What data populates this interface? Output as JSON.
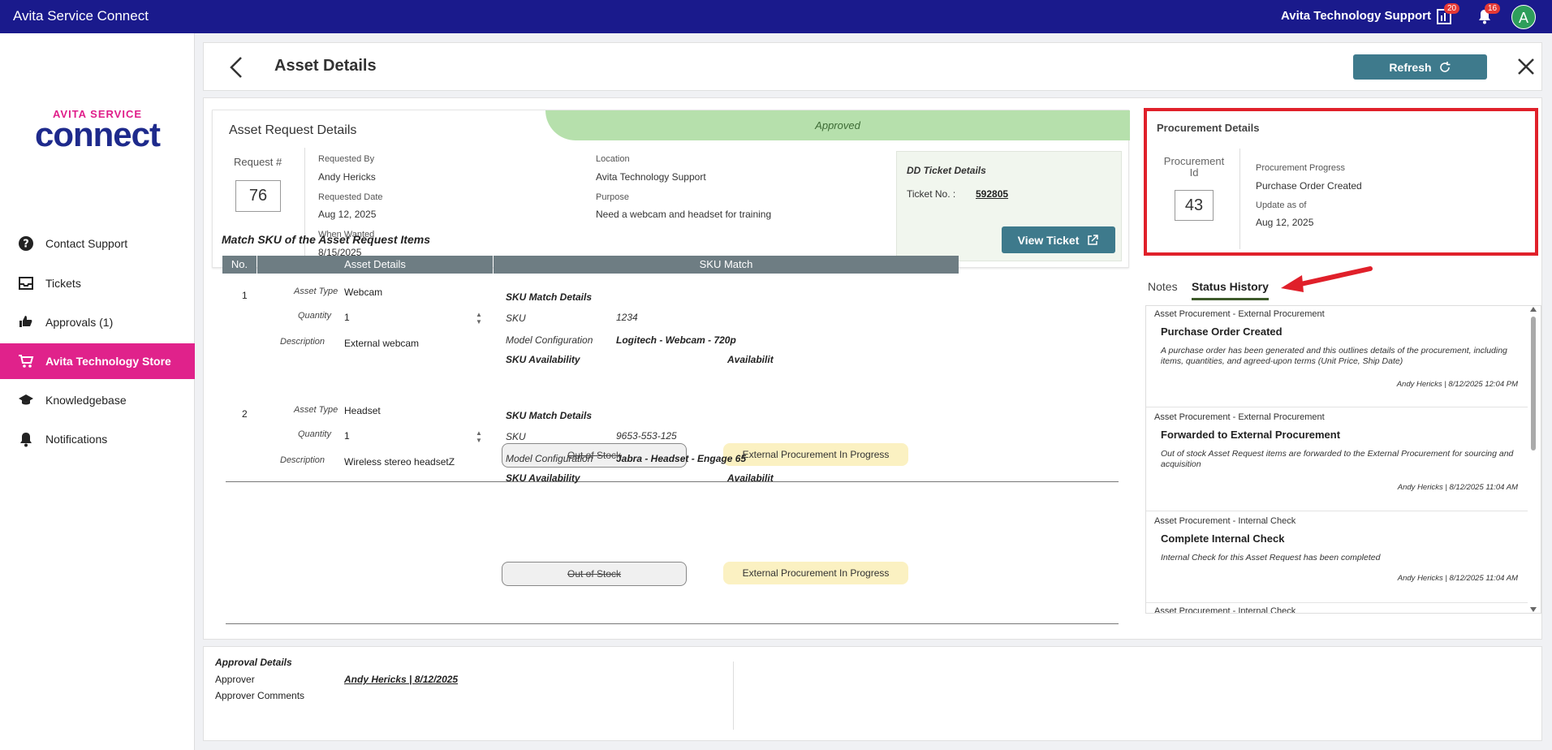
{
  "topbar": {
    "app_title": "Avita Service Connect",
    "org_name": "Avita Technology Support",
    "reports_badge": "20",
    "notifications_badge": "16",
    "avatar_initial": "A"
  },
  "sidebar": {
    "logo_top": "AVITA SERVICE",
    "logo_main": "connect",
    "items": [
      {
        "label": "Contact Support",
        "icon": "question-circle-icon"
      },
      {
        "label": "Tickets",
        "icon": "inbox-icon"
      },
      {
        "label": "Approvals  (1)",
        "icon": "thumbs-icon"
      },
      {
        "label": "Avita Technology Store",
        "icon": "cart-icon"
      },
      {
        "label": "Knowledgebase",
        "icon": "graduation-cap-icon"
      },
      {
        "label": "Notifications",
        "icon": "bell-icon"
      }
    ]
  },
  "header": {
    "title": "Asset Details",
    "refresh_label": "Refresh"
  },
  "request": {
    "section_title": "Asset Request Details",
    "status": "Approved",
    "request_label": "Request #",
    "request_number": "76",
    "requested_by_label": "Requested By",
    "requested_by": "Andy Hericks",
    "requested_date_label": "Requested Date",
    "requested_date": "Aug 12, 2025",
    "when_wanted_label": "When Wanted",
    "when_wanted": "8/15/2025",
    "location_label": "Location",
    "location": "Avita Technology Support",
    "purpose_label": "Purpose",
    "purpose": "Need a webcam and headset for training"
  },
  "dd_ticket": {
    "title": "DD Ticket Details",
    "ticket_label": "Ticket No. :",
    "ticket_number": "592805",
    "view_label": "View Ticket"
  },
  "procurement": {
    "title": "Procurement Details",
    "id_label_1": "Procurement",
    "id_label_2": "Id",
    "id": "43",
    "progress_label": "Procurement Progress",
    "progress": "Purchase Order Created",
    "update_label": "Update as of",
    "update_date": "Aug 12, 2025"
  },
  "tabs": [
    {
      "label": "Notes"
    },
    {
      "label": "Status History"
    }
  ],
  "history": [
    {
      "category": "Asset Procurement - External Procurement",
      "title": "Purchase Order Created",
      "description": "A purchase order has been generated and this outlines details of the procurement, including items, quantities, and agreed-upon terms (Unit Price, Ship Date)",
      "meta": "Andy Hericks  |  8/12/2025 12:04 PM"
    },
    {
      "category": "Asset Procurement - External Procurement",
      "title": "Forwarded to External Procurement",
      "description": "Out of stock Asset Request items are forwarded to the External Procurement for sourcing and acquisition",
      "meta": "Andy Hericks  |  8/12/2025 11:04 AM"
    },
    {
      "category": "Asset Procurement - Internal Check",
      "title": "Complete Internal Check",
      "description": "Internal Check for this Asset Request has been completed",
      "meta": "Andy Hericks  |  8/12/2025 11:04 AM"
    },
    {
      "category": "Asset Procurement - Internal Check",
      "title": "",
      "description": "",
      "meta": ""
    }
  ],
  "sku": {
    "section_title": "Match SKU of the Asset Request Items",
    "col_no": "No.",
    "col_asset": "Asset Details",
    "col_sku": "SKU Match",
    "asset_type_label": "Asset Type",
    "quantity_label": "Quantity",
    "description_label": "Description",
    "match_details_label": "SKU Match Details",
    "sku_label": "SKU",
    "model_label": "Model Configuration",
    "availability_label": "SKU Availability",
    "availabilit_label": "Availabilit",
    "rows": [
      {
        "no": "1",
        "asset_type": "Webcam",
        "quantity": "1",
        "description": "External webcam",
        "sku": "1234",
        "model": "Logitech - Webcam - 720p",
        "stock": "Out of Stock",
        "availability": "External Procurement In Progress"
      },
      {
        "no": "2",
        "asset_type": "Headset",
        "quantity": "1",
        "description": "Wireless stereo headsetZ",
        "sku": "9653-553-125",
        "model": "Jabra - Headset - Engage 65",
        "stock": "Out of Stock",
        "availability": "External Procurement In Progress"
      }
    ]
  },
  "approval": {
    "title": "Approval Details",
    "approver_label": "Approver",
    "approver": "Andy Hericks  |  8/12/2025",
    "comments_label": "Approver Comments"
  },
  "colors": {
    "topbar": "#1a1a8c",
    "active_nav": "#e0228b",
    "button": "#3e7a8c",
    "highlight": "#e0202a",
    "approved": "#b6e0ac"
  }
}
